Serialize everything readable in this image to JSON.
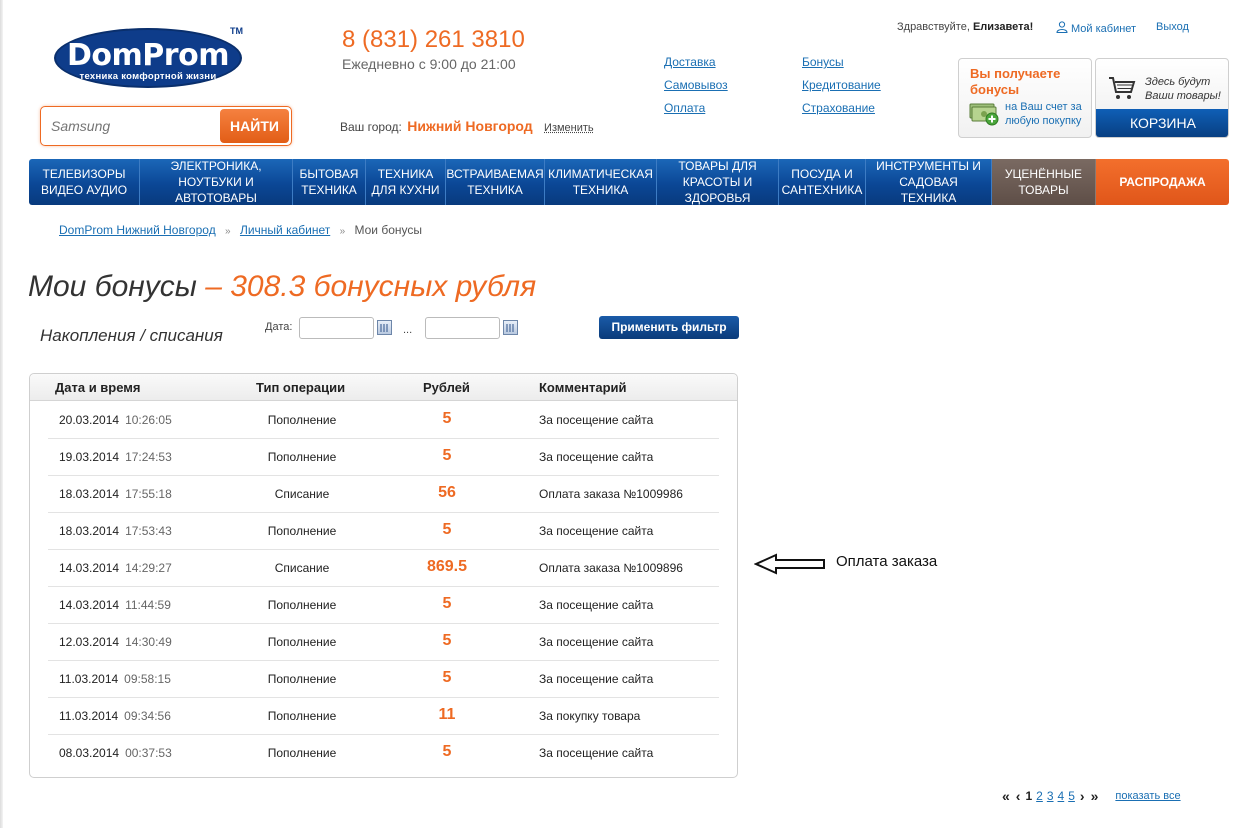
{
  "logo": {
    "name": "DomProm",
    "tagline": "техника комфортной жизни",
    "tm": "TM"
  },
  "search": {
    "value": "",
    "placeholder": "Samsung",
    "button": "НАЙТИ"
  },
  "contact": {
    "phone": "8 (831) 261 3810",
    "hours": "Ежедневно с 9:00 до 21:00"
  },
  "city": {
    "label": "Ваш город:",
    "name": "Нижний Новгород",
    "change": "Изменить"
  },
  "service_links": {
    "col1": [
      "Доставка",
      "Самовывоз",
      "Оплата"
    ],
    "col2": [
      "Бонусы",
      "Кредитование",
      "Страхование"
    ]
  },
  "user": {
    "greeting": "Здравствуйте,",
    "name": "Елизавета!",
    "cabinet": "Мой кабинет",
    "logout": "Выход"
  },
  "bonus_promo": {
    "title": "Вы получаете бонусы",
    "subtitle": "на Ваш счет за любую покупку",
    "icon": "money-plus-icon"
  },
  "cart": {
    "text": "Здесь будут Ваши товары!",
    "button": "КОРЗИНА",
    "icon": "cart-icon"
  },
  "nav": [
    {
      "label": "ТЕЛЕВИЗОРЫ ВИДЕО АУДИО",
      "style": "blue"
    },
    {
      "label": "ЭЛЕКТРОНИКА, НОУТБУКИ И АВТОТОВАРЫ",
      "style": "blue"
    },
    {
      "label": "БЫТОВАЯ ТЕХНИКА",
      "style": "blue"
    },
    {
      "label": "ТЕХНИКА ДЛЯ КУХНИ",
      "style": "blue"
    },
    {
      "label": "ВСТРАИВАЕМАЯ ТЕХНИКА",
      "style": "blue"
    },
    {
      "label": "КЛИМАТИЧЕСКАЯ ТЕХНИКА",
      "style": "blue"
    },
    {
      "label": "ТОВАРЫ ДЛЯ КРАСОТЫ И ЗДОРОВЬЯ",
      "style": "blue"
    },
    {
      "label": "ПОСУДА И САНТЕХНИКА",
      "style": "blue"
    },
    {
      "label": "ИНСТРУМЕНТЫ И САДОВАЯ ТЕХНИКА",
      "style": "blue"
    },
    {
      "label": "УЦЕНЁННЫЕ ТОВАРЫ",
      "style": "gray"
    },
    {
      "label": "РАСПРОДАЖА",
      "style": "orange"
    }
  ],
  "breadcrumb": {
    "items": [
      "DomProm Нижний Новгород",
      "Личный кабинет"
    ],
    "current": "Мои бонусы",
    "separator": "»"
  },
  "page": {
    "title": "Мои бонусы",
    "title_value": "– 308.3 бонусных рубля",
    "subtitle": "Накопления / списания"
  },
  "filter": {
    "date_label": "Дата:",
    "from": "",
    "to": "",
    "range_sep": "...",
    "apply": "Применить фильтр",
    "calendar_icon": "calendar-icon"
  },
  "table": {
    "headers": [
      "Дата и время",
      "Тип операции",
      "Рублей",
      "Комментарий"
    ],
    "rows": [
      {
        "date": "20.03.2014",
        "time": "10:26:05",
        "type": "Пополнение",
        "amount": "5",
        "comment": "За посещение сайта"
      },
      {
        "date": "19.03.2014",
        "time": "17:24:53",
        "type": "Пополнение",
        "amount": "5",
        "comment": "За посещение сайта"
      },
      {
        "date": "18.03.2014",
        "time": "17:55:18",
        "type": "Списание",
        "amount": "56",
        "comment": "Оплата заказа №1009986"
      },
      {
        "date": "18.03.2014",
        "time": "17:53:43",
        "type": "Пополнение",
        "amount": "5",
        "comment": "За посещение сайта"
      },
      {
        "date": "14.03.2014",
        "time": "14:29:27",
        "type": "Списание",
        "amount": "869.5",
        "comment": "Оплата заказа №1009896"
      },
      {
        "date": "14.03.2014",
        "time": "11:44:59",
        "type": "Пополнение",
        "amount": "5",
        "comment": "За посещение сайта"
      },
      {
        "date": "12.03.2014",
        "time": "14:30:49",
        "type": "Пополнение",
        "amount": "5",
        "comment": "За посещение сайта"
      },
      {
        "date": "11.03.2014",
        "time": "09:58:15",
        "type": "Пополнение",
        "amount": "5",
        "comment": "За посещение сайта"
      },
      {
        "date": "11.03.2014",
        "time": "09:34:56",
        "type": "Пополнение",
        "amount": "11",
        "comment": "За покупку товара"
      },
      {
        "date": "08.03.2014",
        "time": "00:37:53",
        "type": "Пополнение",
        "amount": "5",
        "comment": "За посещение сайта"
      }
    ]
  },
  "annotation": {
    "text": "Оплата заказа",
    "icon": "arrow-left-icon"
  },
  "pagination": {
    "first": "«",
    "prev": "‹",
    "current": "1",
    "pages": [
      "2",
      "3",
      "4",
      "5"
    ],
    "next": "›",
    "last": "»",
    "show_all": "показать все"
  },
  "colors": {
    "accent": "#ee6a23",
    "brand_blue": "#0b4796",
    "link": "#1a6fb3"
  }
}
